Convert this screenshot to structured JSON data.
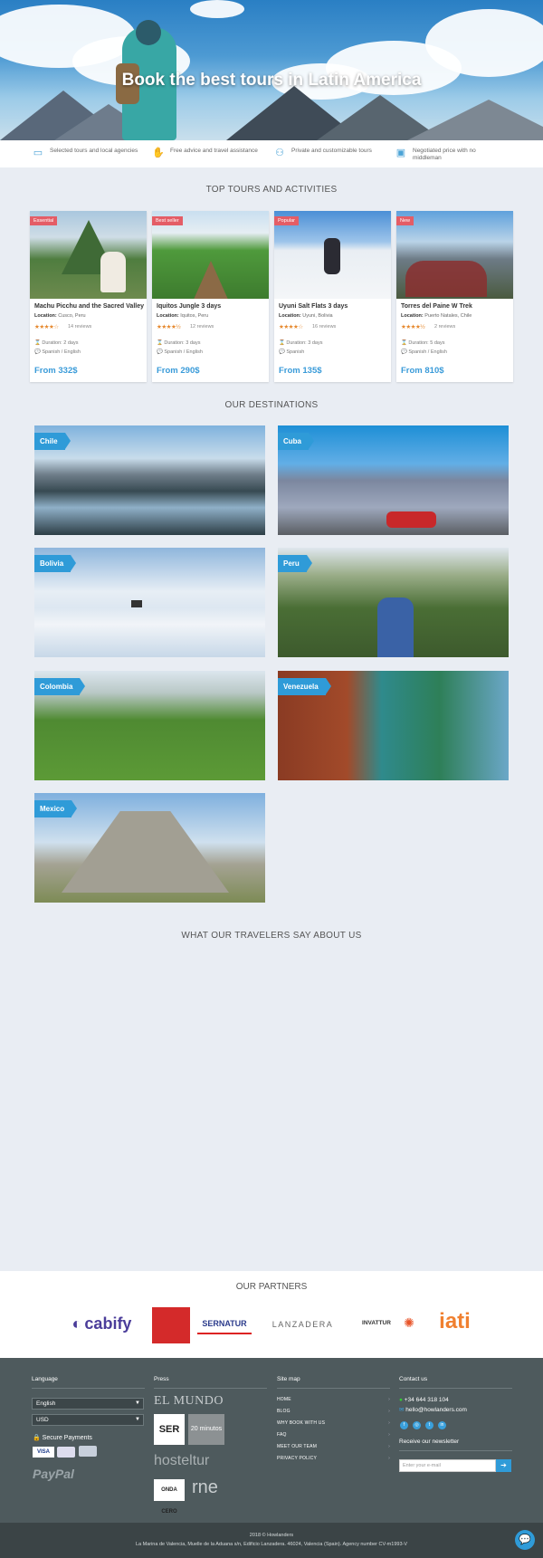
{
  "hero": {
    "title": "Book the best tours in Latin America"
  },
  "features": [
    {
      "icon": "map-icon",
      "text": "Selected tours and local agencies"
    },
    {
      "icon": "handshake-icon",
      "text": "Free advice and travel assistance"
    },
    {
      "icon": "person-icon",
      "text": "Private and customizable tours"
    },
    {
      "icon": "wallet-icon",
      "text": "Negotiated price with no middleman"
    }
  ],
  "sections": {
    "tours": "TOP TOURS AND ACTIVITIES",
    "destinations": "OUR DESTINATIONS",
    "testimonials": "WHAT OUR TRAVELERS SAY ABOUT US",
    "partners": "OUR PARTNERS"
  },
  "tours": [
    {
      "badge": "Essential",
      "name": "Machu Picchu and the Sacred Valley",
      "location_label": "Location:",
      "location": "Cusco, Peru",
      "stars": "★★★★☆",
      "reviews": "14 reviews",
      "duration": "Duration: 2 days",
      "languages": "Spanish / English",
      "price": "From 332$"
    },
    {
      "badge": "Best seller",
      "name": "Iquitos Jungle 3 days",
      "location_label": "Location:",
      "location": "Iquitos, Peru",
      "stars": "★★★★½",
      "reviews": "12 reviews",
      "duration": "Duration: 3 days",
      "languages": "Spanish / English",
      "price": "From 290$"
    },
    {
      "badge": "Popular",
      "name": "Uyuni Salt Flats 3 days",
      "location_label": "Location:",
      "location": "Uyuni, Bolivia",
      "stars": "★★★★☆",
      "reviews": "16 reviews",
      "duration": "Duration: 3 days",
      "languages": "Spanish",
      "price": "From 135$"
    },
    {
      "badge": "New",
      "name": "Torres del Paine W Trek",
      "location_label": "Location:",
      "location": "Puerto Natales, Chile",
      "stars": "★★★★½",
      "reviews": "2 reviews",
      "duration": "Duration: 5 days",
      "languages": "Spanish / English",
      "price": "From 810$"
    }
  ],
  "destinations": [
    "Chile",
    "Cuba",
    "Bolivia",
    "Peru",
    "Colombia",
    "Venezuela",
    "Mexico"
  ],
  "partners": [
    "cabify",
    "SERNATUR",
    "LANZADERA",
    "INVATTUR",
    "iati"
  ],
  "footer": {
    "language": {
      "heading": "Language",
      "language_value": "English",
      "currency_value": "USD",
      "secure_payments": "Secure Payments",
      "paypal": "PayPal"
    },
    "press": {
      "heading": "Press",
      "items": [
        "EL MUNDO",
        "SER",
        "20 minutos",
        "hosteltur",
        "ONDA CERO",
        "rne"
      ]
    },
    "sitemap": {
      "heading": "Site map",
      "items": [
        "HOME",
        "BLOG",
        "WHY BOOK WITH US",
        "FAQ",
        "MEET OUR TEAM",
        "PRIVACY POLICY"
      ]
    },
    "contact": {
      "heading": "Contact us",
      "phone": "+34 644 318 104",
      "email": "hello@howlanders.com",
      "newsletter_heading": "Receive our newsletter",
      "newsletter_placeholder": "Enter your e-mail"
    }
  },
  "bottom": {
    "copyright": "2018 © Howlanders",
    "address": "La Marina de Valencia, Muelle de la Aduana s/n, Edificio Lanzadera. 46024, Valencia (Spain). Agency number CV-m1993-V"
  },
  "colors": {
    "accent": "#2f9bd8",
    "badge": "#e45d66",
    "footer": "#4e5a5d",
    "stars": "#e6882c"
  }
}
